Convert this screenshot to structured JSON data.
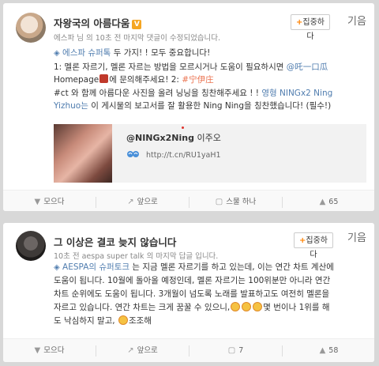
{
  "posts": [
    {
      "author": "자왕국의 아름다움",
      "verified_badge": "V",
      "meta": "에스파 님 의 10초 전 마지막 댓글이 수정되었습니다.",
      "follow_label": "집중하다",
      "side_label": "기음",
      "lines": {
        "l1_tag": "에스파 슈퍼톡",
        "l1_rest": " 두 가지! ! 모두 중요합니다!",
        "l2_a": "1: 멜론 자르기, 멜론 자르는 방법을 모르시거나 도움이 필요하시면 ",
        "l2_mention": "@吒一口瓜",
        "l3_a": "Homepage",
        "l3_b": "에 문의해주세요! 2: ",
        "l3_tag": "#宁伊庄",
        "l4_a": "#ct 와 함께 아름다운 사진을 올려 닝닝을 칭찬해주세요 ! ! ",
        "l4_link": "영형 NINGx2 Ning",
        "l5_link": "Yizhuo는",
        "l5_rest": " 이 게시물의 보고서를 잘 활용한 Ning Ning을 칭찬했습니다! (필수!)"
      },
      "share": {
        "title_bold": "@NINGx2Ning",
        "title_normal": " 이주오",
        "url": "http://t.cn/RU1yaH1"
      },
      "actions": {
        "forward": "모으다",
        "comment": "앞으로",
        "like_or_retweet": "스물 하나",
        "likes": "65"
      }
    },
    {
      "author": "그 이상은 결코 늦지 않습니다",
      "meta": "10초 전 aespa super talk 의 마지막 답글 입니다.",
      "follow_label": "집중하다",
      "side_label": "기음",
      "lines": {
        "l1_tag": "AESPA의 슈퍼토크",
        "l1_rest": " 는 지금 멜론 자르기를 하고 있는데, 이는 연간 차트 계산에",
        "l2": "도움이 됩니다. 10월에 돌아올 예정인데, 멜론 자르기는 100위분만 아니라 연간",
        "l3": "차트 순위에도 도움이 됩니다. 3개월이 넘도록 노래를 발표하고도 여전히 멜론을",
        "l4_a": "자르고 있습니다. 연간 차트는 크게 꿈꿀 수 있으니,",
        "l4_b": "몇 번이나 1위를 해",
        "l5_a": "도 낙심하지 말고,",
        "l5_b": "조조해"
      },
      "actions": {
        "forward": "모으다",
        "comment": "앞으로",
        "comments_count": "7",
        "likes": "58"
      }
    }
  ],
  "colors": {
    "accent": "#ff8200",
    "link": "#eb7350",
    "blue_link": "#507daf"
  }
}
